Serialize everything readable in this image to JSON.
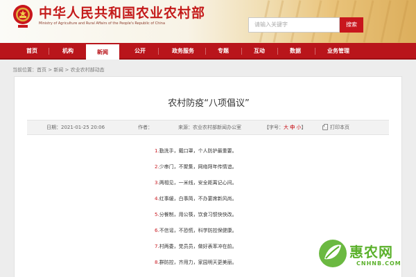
{
  "header": {
    "title": "中华人民共和国农业农村部",
    "subtitle": "Ministry of Agriculture and Rural Affairs of the People's Republic of China",
    "search_placeholder": "请输入关键字",
    "search_button": "搜索"
  },
  "nav": {
    "items": [
      {
        "label": "首页"
      },
      {
        "label": "机构"
      },
      {
        "label": "新闻",
        "active": true
      },
      {
        "label": "公开"
      },
      {
        "label": "政务服务"
      },
      {
        "label": "专题"
      },
      {
        "label": "互动"
      },
      {
        "label": "数据"
      },
      {
        "label": "业务管理"
      }
    ]
  },
  "breadcrumb": "当前位置：首页 > 新闻 > 农业农村部动态",
  "article": {
    "title": "农村防疫“八项倡议”",
    "date": "日期：2021-01-25 20:06",
    "author": "作者：",
    "source": "来源：农业农村部新闻办公室",
    "font_size_label": "【字号：",
    "font_big": "大",
    "font_mid": "中",
    "font_small": "小",
    "font_size_end": "】",
    "print": "打印本页",
    "items": [
      {
        "num": "1.",
        "text": "勤洗手，戴口罩，个人防护最重要。"
      },
      {
        "num": "2.",
        "text": "少串门，不聚集，网络拜年传情谊。"
      },
      {
        "num": "3.",
        "text": "两相见，一米线，安全距离记心间。"
      },
      {
        "num": "4.",
        "text": "红事缓，白事简，不办宴席新风尚。"
      },
      {
        "num": "5.",
        "text": "分餐制，用公筷，饮食习惯快快改。"
      },
      {
        "num": "6.",
        "text": "不信谣，不恐慌，科学防控保健康。"
      },
      {
        "num": "7.",
        "text": "村两委，党员员，做好表率冲在前。"
      },
      {
        "num": "8.",
        "text": "群防控，齐用力，家园明天更美丽。"
      }
    ]
  },
  "watermark": {
    "name": "惠农网",
    "domain": "CNHNB.COM"
  },
  "colors": {
    "brand_red": "#c8161d",
    "nav_red": "#b9151b",
    "watermark_green": "#5bb12c"
  }
}
